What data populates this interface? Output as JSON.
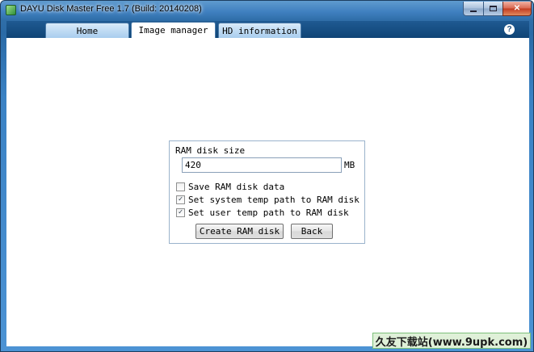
{
  "window": {
    "title": "DAYU Disk Master Free 1.7 (Build: 20140208)",
    "icon": "app-icon",
    "controls": {
      "minimize": "minimize-icon",
      "maximize": "maximize-icon",
      "close": "close-icon",
      "close_glyph": "✕"
    }
  },
  "tabs": [
    {
      "label": "Home",
      "active": false
    },
    {
      "label": "Image manager",
      "active": true
    },
    {
      "label": "HD information",
      "active": false
    }
  ],
  "help": {
    "glyph": "?",
    "icon": "help-icon"
  },
  "ram_disk": {
    "size_label": "RAM disk size",
    "size_value": "420",
    "unit": "MB",
    "options": [
      {
        "label": "Save RAM disk data",
        "checked": false
      },
      {
        "label": "Set system temp path to RAM disk",
        "checked": true
      },
      {
        "label": "Set user temp path to RAM disk",
        "checked": true
      }
    ],
    "check_glyph": "✓",
    "create_label": "Create RAM disk",
    "back_label": "Back"
  },
  "watermark": "久友下载站(www.9upk.com)",
  "colors": {
    "titlebar": "#3f7fbf",
    "tab_strip": "#1f5a92",
    "active_tab": "#ffffff",
    "panel_border": "#9ab3cc"
  }
}
